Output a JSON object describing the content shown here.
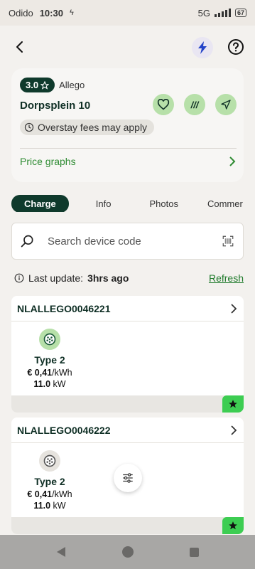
{
  "status_bar": {
    "carrier": "Odido",
    "time": "10:30",
    "network": "5G",
    "battery": "67"
  },
  "topbar": {
    "back_icon": "back-arrow-icon",
    "bolt_icon": "bolt-icon",
    "help_icon": "help-icon"
  },
  "station": {
    "rating": "3.0",
    "operator": "Allego",
    "name": "Dorpsplein 10",
    "fees_notice": "Overstay fees may apply",
    "price_graphs_label": "Price graphs"
  },
  "tabs": [
    {
      "label": "Charge",
      "active": true
    },
    {
      "label": "Info",
      "active": false
    },
    {
      "label": "Photos",
      "active": false
    },
    {
      "label": "Commer",
      "active": false
    }
  ],
  "search": {
    "placeholder": "Search device code"
  },
  "update": {
    "label": "Last update:",
    "value": "3hrs ago",
    "refresh": "Refresh"
  },
  "devices": [
    {
      "code": "NLALLEGO0046221",
      "connector": {
        "type": "Type 2",
        "price_prefix": "€ 0,41",
        "price_unit": "/kWh",
        "power_value": "11.0",
        "power_unit": " kW",
        "available": true
      }
    },
    {
      "code": "NLALLEGO0046222",
      "connector": {
        "type": "Type 2",
        "price_prefix": "€ 0,41",
        "price_unit": "/kWh",
        "power_value": "11.0",
        "power_unit": " kW",
        "available": false
      }
    }
  ],
  "colors": {
    "accent_dark": "#0f3a2c",
    "accent_green": "#2e8b32",
    "available_plug": "#b7e0a9",
    "favorite_badge": "#3dcd52"
  }
}
